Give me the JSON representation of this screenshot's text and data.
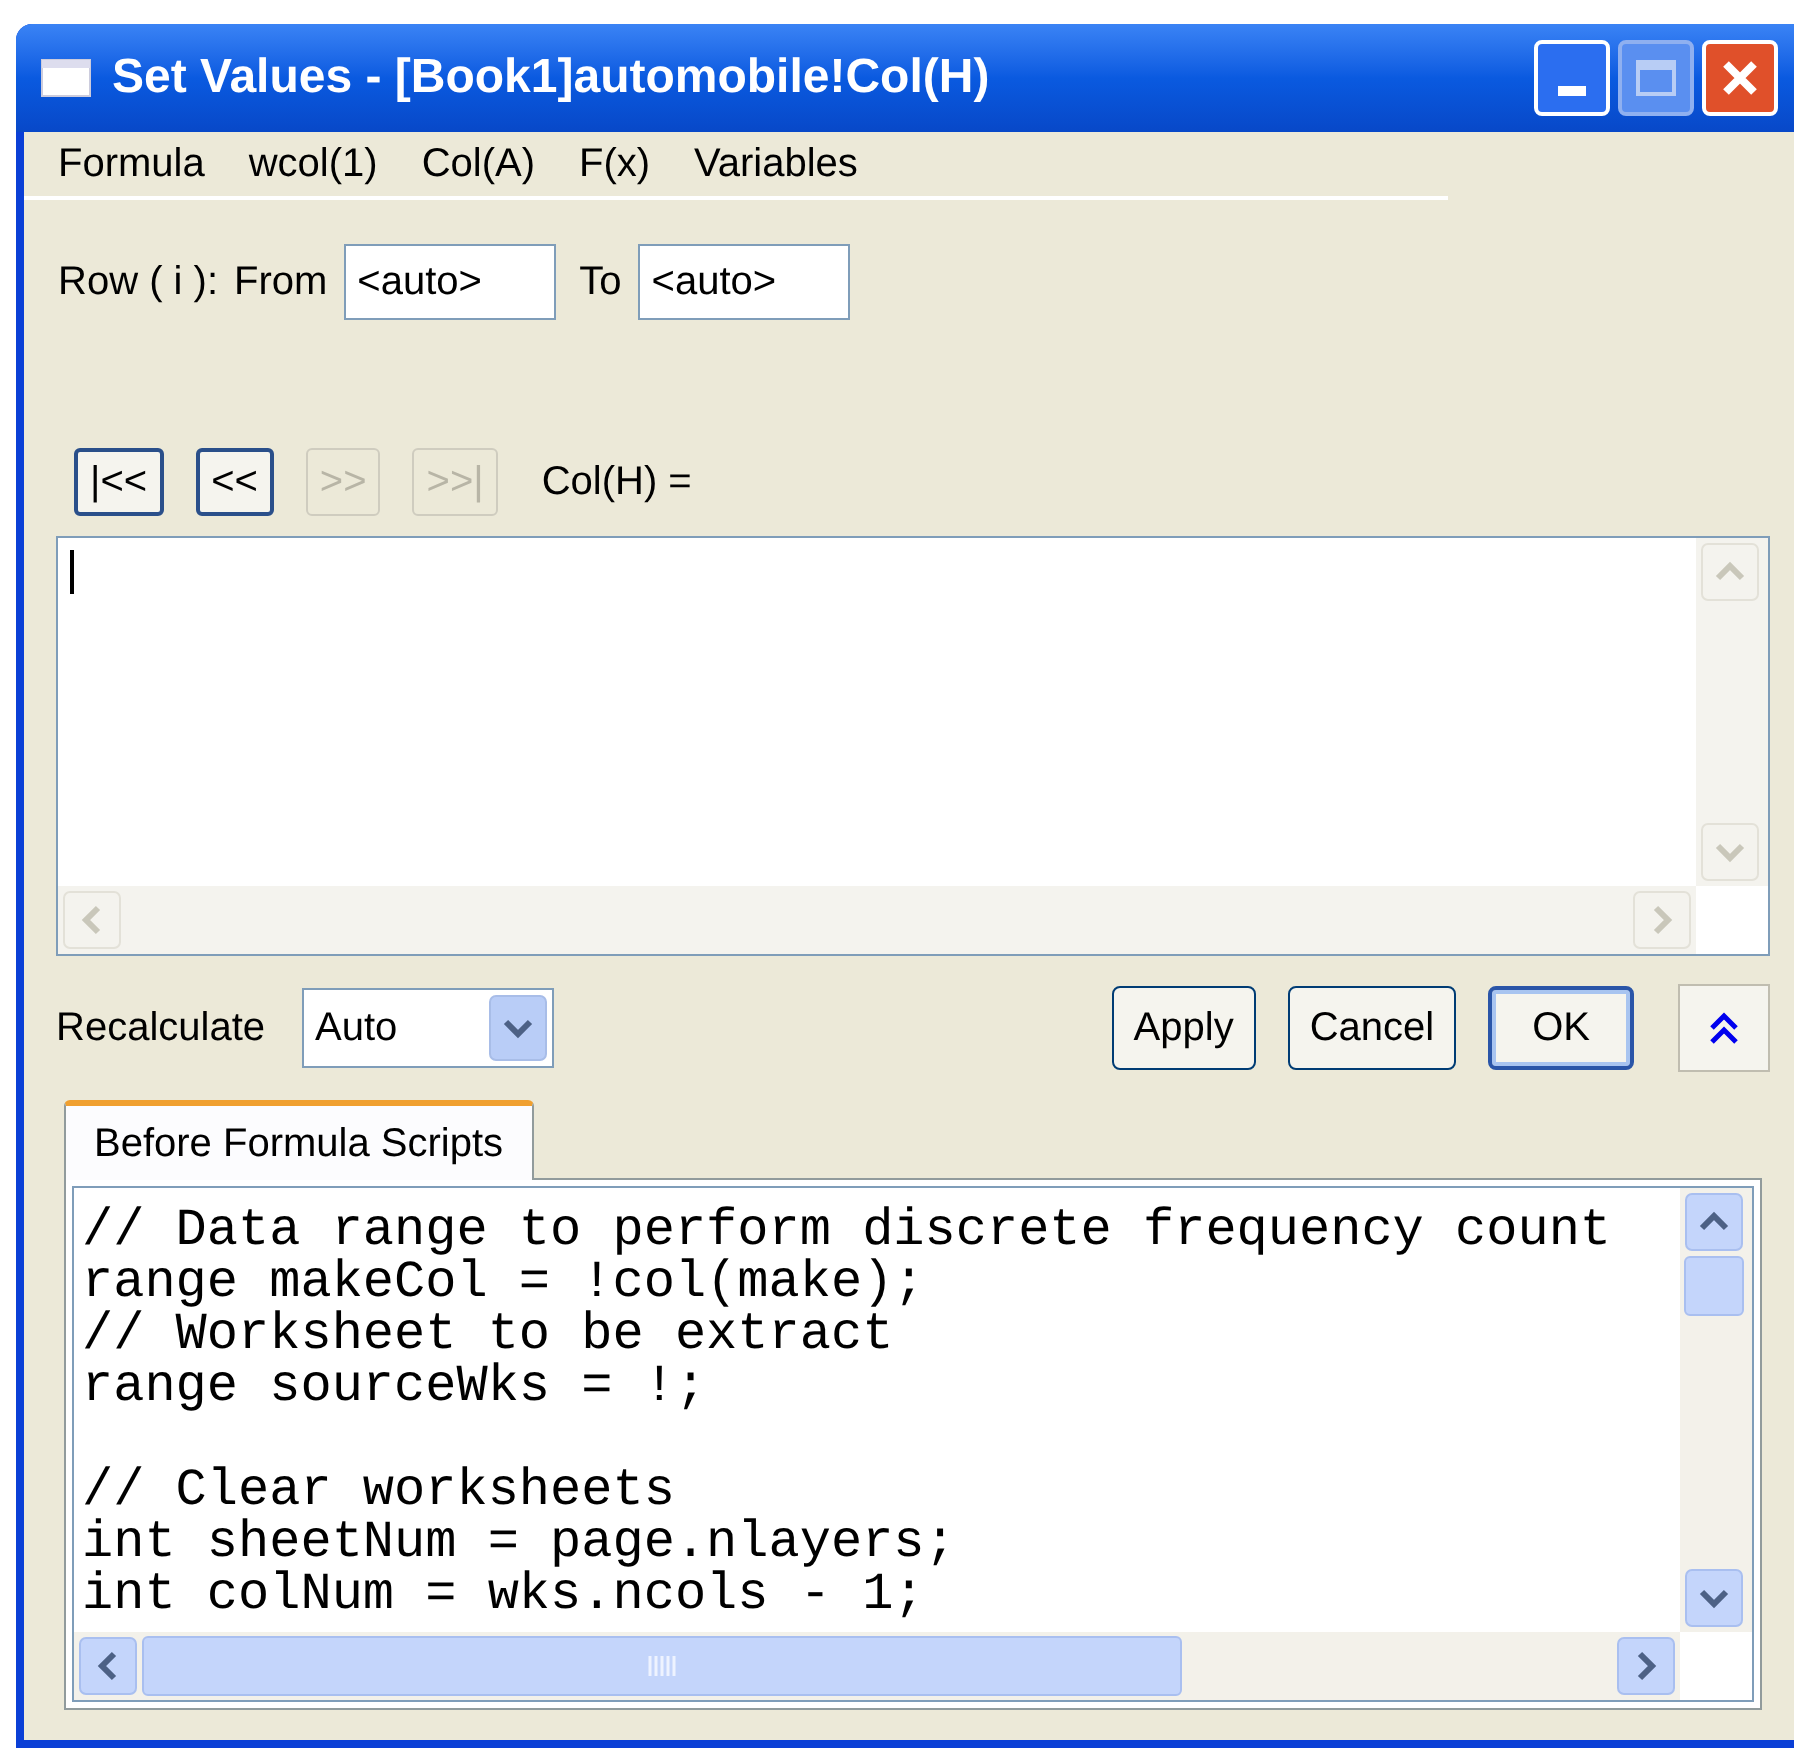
{
  "window": {
    "title": "Set Values - [Book1]automobile!Col(H)"
  },
  "menu": [
    "Formula",
    "wcol(1)",
    "Col(A)",
    "F(x)",
    "Variables"
  ],
  "row_range": {
    "label": "Row ( i ):",
    "from_label": "From",
    "from_value": "<auto>",
    "to_label": "To",
    "to_value": "<auto>"
  },
  "nav_buttons": [
    {
      "label": "|<<",
      "disabled": false
    },
    {
      "label": "<<",
      "disabled": false
    },
    {
      "label": ">>",
      "disabled": true
    },
    {
      "label": ">>|",
      "disabled": true
    }
  ],
  "formula_label": "Col(H) =",
  "recalculate": {
    "label": "Recalculate",
    "value": "Auto"
  },
  "buttons": [
    {
      "label": "Apply",
      "default": false
    },
    {
      "label": "Cancel",
      "default": false
    },
    {
      "label": "OK",
      "default": true
    }
  ],
  "tabs": [
    {
      "label": "Before Formula Scripts",
      "selected": true
    }
  ],
  "script_blocks": [
    [
      "// Data range to perform discrete frequency count",
      "range makeCol = !col(make);",
      "// Worksheet to be extract",
      "range sourceWks = !;"
    ],
    [
      "// Clear worksheets",
      "int sheetNum = page.nlayers;",
      "int colNum = wks.ncols - 1;"
    ]
  ]
}
